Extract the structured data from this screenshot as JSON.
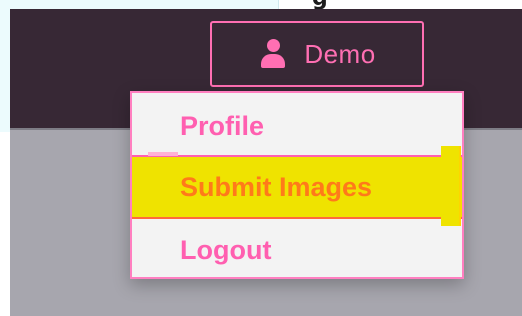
{
  "header": {
    "cut_title": "g"
  },
  "account": {
    "username": "Demo",
    "icon": "user-icon"
  },
  "dropdown": {
    "items": [
      {
        "label": "Profile"
      },
      {
        "label": "Submit Images"
      },
      {
        "label": "Logout"
      }
    ]
  },
  "colors": {
    "navbar": "#372835",
    "accent_pink": "#ff6fb3",
    "highlight_yellow": "#efe300",
    "highlight_text": "#ff7a1a",
    "menu_bg": "#f3f3f3",
    "content_bg": "#a7a6ae"
  }
}
